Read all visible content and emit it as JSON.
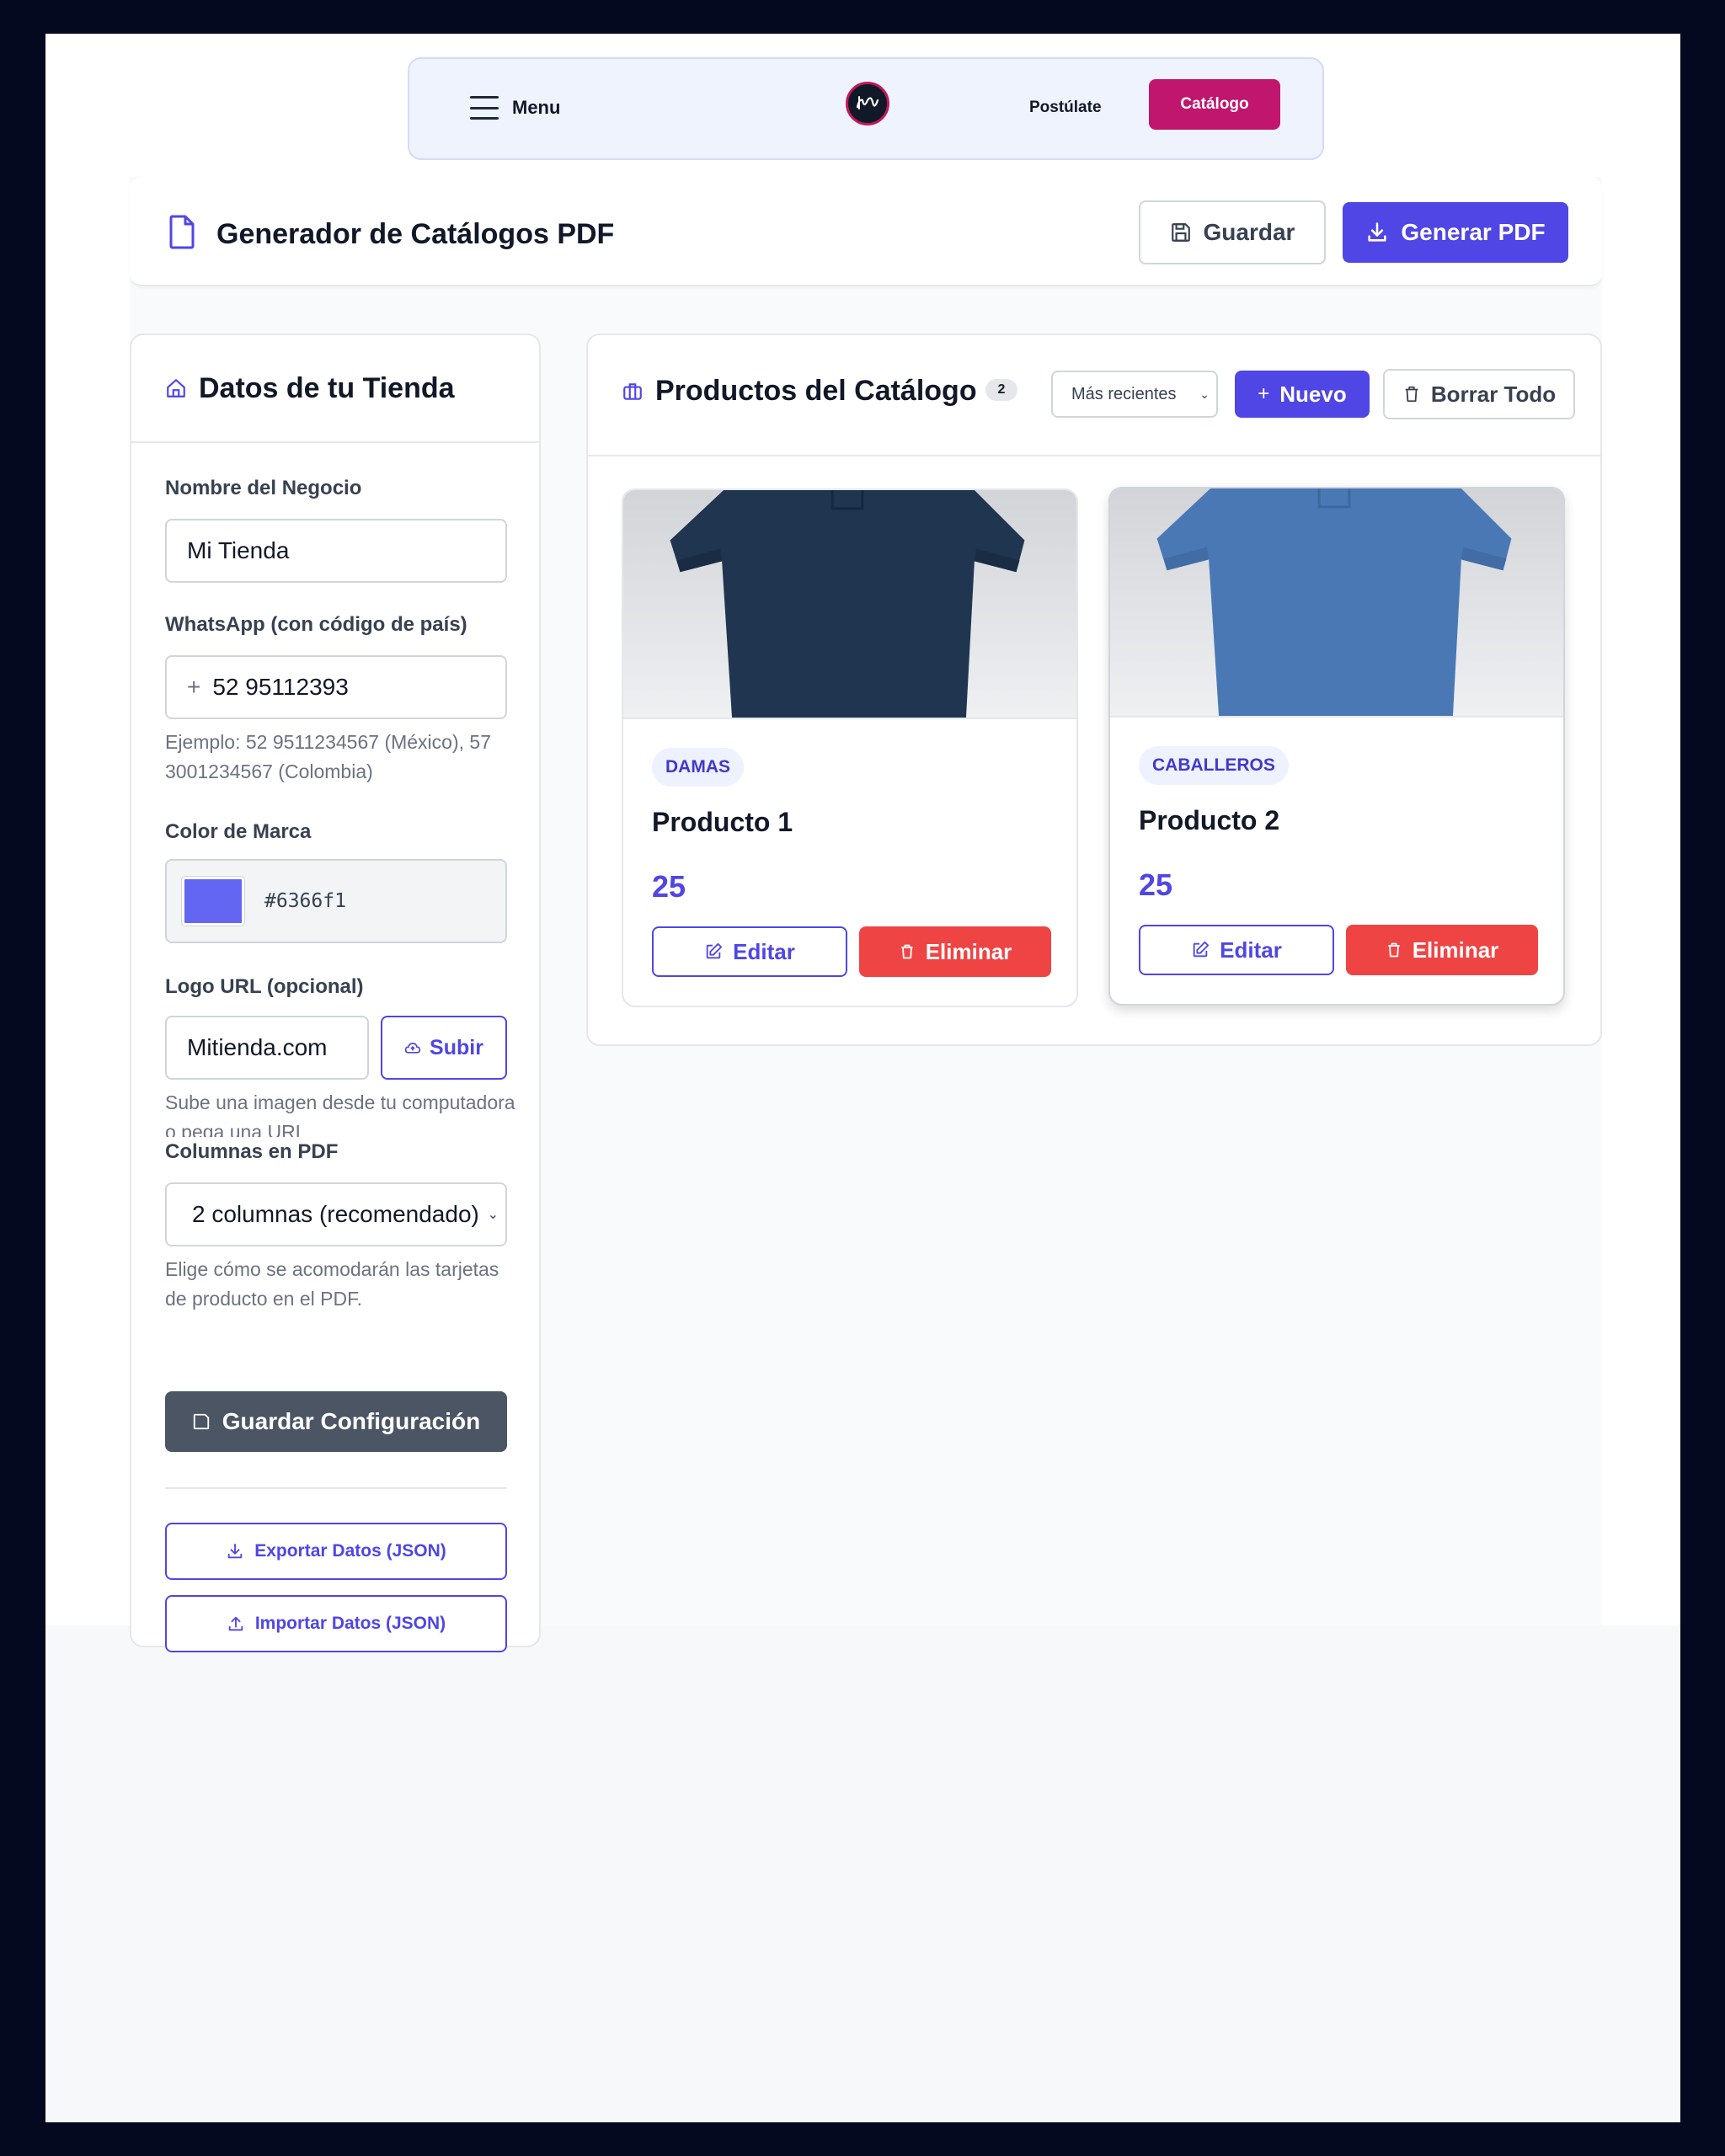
{
  "nav": {
    "menu_label": "Menu",
    "logo_alt": "tps",
    "links": [
      {
        "label": "Postúlate"
      },
      {
        "label": "Catálogo"
      }
    ]
  },
  "header": {
    "title": "Generador de Catálogos PDF",
    "save_label": "Guardar",
    "pdf_label": "Generar PDF"
  },
  "store": {
    "title": "Datos de tu Tienda",
    "business_label": "Nombre del Negocio",
    "business_value": "Mi Tienda",
    "whatsapp_label": "WhatsApp (con código de país)",
    "whatsapp_prefix": "+",
    "whatsapp_value": "52 95112393",
    "whatsapp_hint": "Ejemplo: 52 9511234567 (México), 57 3001234567 (Colombia)",
    "color_label": "Color de Marca",
    "color_value": "#6366f1",
    "logo_label": "Logo URL (opcional)",
    "logo_value": "Mitienda.com",
    "upload_label": "Subir",
    "logo_hint": "Sube una imagen desde tu computadora o pega una URL",
    "columns_label": "Columnas en PDF",
    "columns_value": "2 columnas (recomendado)",
    "columns_hint": "Elige cómo se acomodarán las tarjetas de producto en el PDF.",
    "save_config_label": "Guardar Configuración",
    "export_label": "Exportar Datos (JSON)",
    "import_label": "Importar Datos (JSON)"
  },
  "products": {
    "title": "Productos del Catálogo",
    "count": "2",
    "sort_value": "Más recientes",
    "new_label": "Nuevo",
    "clear_label": "Borrar Todo",
    "items": [
      {
        "category": "DAMAS",
        "name": "Producto 1",
        "price": "25",
        "edit_label": "Editar",
        "delete_label": "Eliminar",
        "shirt_color": "#1f3550"
      },
      {
        "category": "CABALLEROS",
        "name": "Producto 2",
        "price": "25",
        "edit_label": "Editar",
        "delete_label": "Eliminar",
        "shirt_color": "#4a78b5"
      }
    ]
  },
  "colors": {
    "accent": "#4f46e5",
    "brand_swatch": "#6366f1",
    "nav_active": "#c0166d",
    "danger": "#ef4444",
    "dark_button": "#4b5563"
  }
}
